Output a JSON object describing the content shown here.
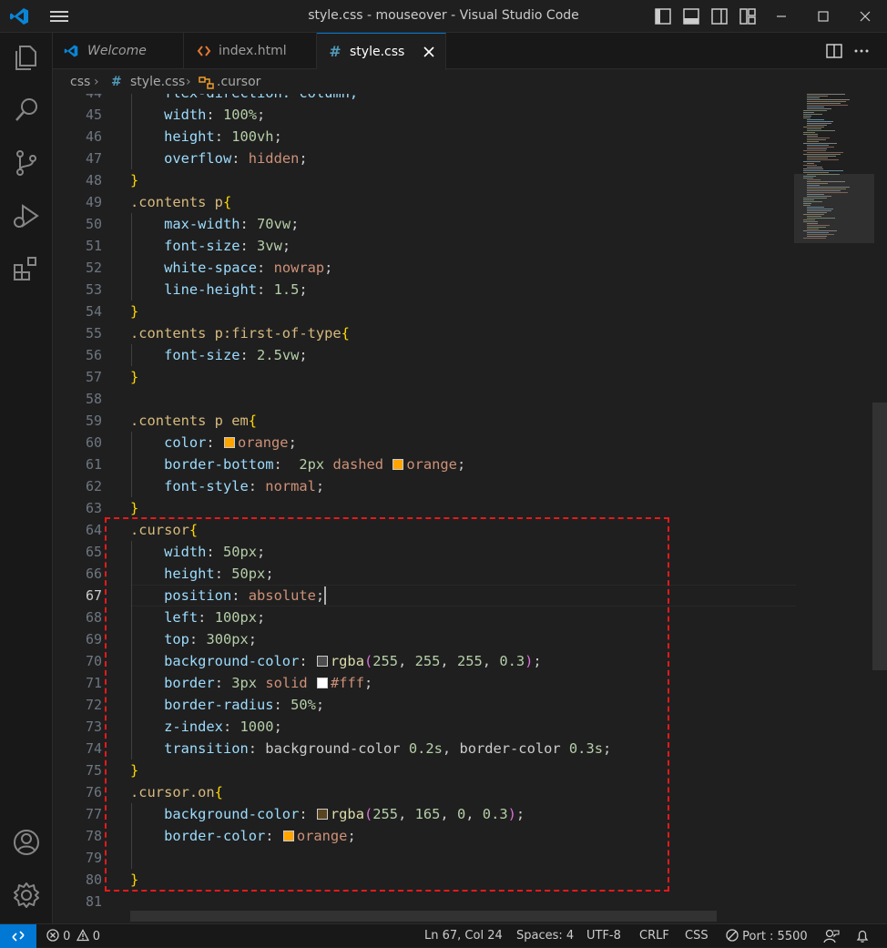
{
  "window": {
    "title": "style.css - mouseover - Visual Studio Code"
  },
  "titlebar": {
    "icons": [
      "vscode-logo-icon",
      "menu-icon",
      "toggle-primary-sidebar-icon",
      "toggle-panel-icon",
      "toggle-secondary-sidebar-icon",
      "customize-layout-icon",
      "minimize-icon",
      "maximize-icon",
      "close-icon"
    ]
  },
  "activity_bar": {
    "items": [
      "explorer-icon",
      "search-icon",
      "source-control-icon",
      "run-debug-icon",
      "extensions-icon",
      "account-icon",
      "manage-gear-icon"
    ]
  },
  "tabs": [
    {
      "label": "Welcome",
      "icon": "vscode-logo-icon",
      "active": false
    },
    {
      "label": "index.html",
      "icon": "html-icon",
      "active": false
    },
    {
      "label": "style.css",
      "icon": "css-hash-icon",
      "active": true
    }
  ],
  "breadcrumb": {
    "folder": "css",
    "file": "style.css",
    "symbol": ".cursor"
  },
  "editor": {
    "first_partial_line_number": "44",
    "first_partial_line_text": "    flex-direction: column;",
    "current_line": "67",
    "lines": [
      {
        "n": "45",
        "tokens": [
          [
            "ind",
            "    "
          ],
          [
            "prop",
            "width"
          ],
          [
            "p",
            ": "
          ],
          [
            "num",
            "100%"
          ],
          [
            "p",
            ";"
          ]
        ]
      },
      {
        "n": "46",
        "tokens": [
          [
            "ind",
            "    "
          ],
          [
            "prop",
            "height"
          ],
          [
            "p",
            ": "
          ],
          [
            "num",
            "100vh"
          ],
          [
            "p",
            ";"
          ]
        ]
      },
      {
        "n": "47",
        "tokens": [
          [
            "ind",
            "    "
          ],
          [
            "prop",
            "overflow"
          ],
          [
            "p",
            ": "
          ],
          [
            "val",
            "hidden"
          ],
          [
            "p",
            ";"
          ]
        ]
      },
      {
        "n": "48",
        "tokens": [
          [
            "br",
            "}"
          ]
        ]
      },
      {
        "n": "49",
        "tokens": [
          [
            "sel",
            ".contents p"
          ],
          [
            "br",
            "{"
          ]
        ]
      },
      {
        "n": "50",
        "tokens": [
          [
            "ind",
            "    "
          ],
          [
            "prop",
            "max-width"
          ],
          [
            "p",
            ": "
          ],
          [
            "num",
            "70vw"
          ],
          [
            "p",
            ";"
          ]
        ]
      },
      {
        "n": "51",
        "tokens": [
          [
            "ind",
            "    "
          ],
          [
            "prop",
            "font-size"
          ],
          [
            "p",
            ": "
          ],
          [
            "num",
            "3vw"
          ],
          [
            "p",
            ";"
          ]
        ]
      },
      {
        "n": "52",
        "tokens": [
          [
            "ind",
            "    "
          ],
          [
            "prop",
            "white-space"
          ],
          [
            "p",
            ": "
          ],
          [
            "val",
            "nowrap"
          ],
          [
            "p",
            ";"
          ]
        ]
      },
      {
        "n": "53",
        "tokens": [
          [
            "ind",
            "    "
          ],
          [
            "prop",
            "line-height"
          ],
          [
            "p",
            ": "
          ],
          [
            "num",
            "1.5"
          ],
          [
            "p",
            ";"
          ]
        ]
      },
      {
        "n": "54",
        "tokens": [
          [
            "br",
            "}"
          ]
        ]
      },
      {
        "n": "55",
        "tokens": [
          [
            "sel",
            ".contents p:first-of-type"
          ],
          [
            "br",
            "{"
          ]
        ]
      },
      {
        "n": "56",
        "tokens": [
          [
            "ind",
            "    "
          ],
          [
            "prop",
            "font-size"
          ],
          [
            "p",
            ": "
          ],
          [
            "num",
            "2.5vw"
          ],
          [
            "p",
            ";"
          ]
        ]
      },
      {
        "n": "57",
        "tokens": [
          [
            "br",
            "}"
          ]
        ]
      },
      {
        "n": "58",
        "tokens": []
      },
      {
        "n": "59",
        "tokens": [
          [
            "sel",
            ".contents p em"
          ],
          [
            "br",
            "{"
          ]
        ]
      },
      {
        "n": "60",
        "tokens": [
          [
            "ind",
            "    "
          ],
          [
            "prop",
            "color"
          ],
          [
            "p",
            ": "
          ],
          [
            "sw",
            "#ffa500"
          ],
          [
            "val",
            "orange"
          ],
          [
            "p",
            ";"
          ]
        ]
      },
      {
        "n": "61",
        "tokens": [
          [
            "ind",
            "    "
          ],
          [
            "prop",
            "border-bottom"
          ],
          [
            "p",
            ":  "
          ],
          [
            "num",
            "2px"
          ],
          [
            "p",
            " "
          ],
          [
            "val",
            "dashed"
          ],
          [
            "p",
            " "
          ],
          [
            "sw",
            "#ffa500"
          ],
          [
            "val",
            "orange"
          ],
          [
            "p",
            ";"
          ]
        ]
      },
      {
        "n": "62",
        "tokens": [
          [
            "ind",
            "    "
          ],
          [
            "prop",
            "font-style"
          ],
          [
            "p",
            ": "
          ],
          [
            "val",
            "normal"
          ],
          [
            "p",
            ";"
          ]
        ]
      },
      {
        "n": "63",
        "tokens": [
          [
            "br",
            "}"
          ]
        ]
      },
      {
        "n": "64",
        "tokens": [
          [
            "sel",
            ".cursor"
          ],
          [
            "br",
            "{"
          ]
        ]
      },
      {
        "n": "65",
        "tokens": [
          [
            "ind",
            "    "
          ],
          [
            "prop",
            "width"
          ],
          [
            "p",
            ": "
          ],
          [
            "num",
            "50px"
          ],
          [
            "p",
            ";"
          ]
        ]
      },
      {
        "n": "66",
        "tokens": [
          [
            "ind",
            "    "
          ],
          [
            "prop",
            "height"
          ],
          [
            "p",
            ": "
          ],
          [
            "num",
            "50px"
          ],
          [
            "p",
            ";"
          ]
        ]
      },
      {
        "n": "67",
        "tokens": [
          [
            "ind",
            "    "
          ],
          [
            "prop",
            "position"
          ],
          [
            "p",
            ": "
          ],
          [
            "val",
            "absolute"
          ],
          [
            "p",
            ";"
          ]
        ]
      },
      {
        "n": "68",
        "tokens": [
          [
            "ind",
            "    "
          ],
          [
            "prop",
            "left"
          ],
          [
            "p",
            ": "
          ],
          [
            "num",
            "100px"
          ],
          [
            "p",
            ";"
          ]
        ]
      },
      {
        "n": "69",
        "tokens": [
          [
            "ind",
            "    "
          ],
          [
            "prop",
            "top"
          ],
          [
            "p",
            ": "
          ],
          [
            "num",
            "300px"
          ],
          [
            "p",
            ";"
          ]
        ]
      },
      {
        "n": "70",
        "tokens": [
          [
            "ind",
            "    "
          ],
          [
            "prop",
            "background-color"
          ],
          [
            "p",
            ": "
          ],
          [
            "sw",
            "#4d4d4d"
          ],
          [
            "fn",
            "rgba"
          ],
          [
            "pn",
            "("
          ],
          [
            "num",
            "255"
          ],
          [
            "p",
            ", "
          ],
          [
            "num",
            "255"
          ],
          [
            "p",
            ", "
          ],
          [
            "num",
            "255"
          ],
          [
            "p",
            ", "
          ],
          [
            "num",
            "0.3"
          ],
          [
            "pn",
            ")"
          ],
          [
            "p",
            ";"
          ]
        ]
      },
      {
        "n": "71",
        "tokens": [
          [
            "ind",
            "    "
          ],
          [
            "prop",
            "border"
          ],
          [
            "p",
            ": "
          ],
          [
            "num",
            "3px"
          ],
          [
            "p",
            " "
          ],
          [
            "val",
            "solid"
          ],
          [
            "p",
            " "
          ],
          [
            "sw",
            "#ffffff"
          ],
          [
            "val",
            "#fff"
          ],
          [
            "p",
            ";"
          ]
        ]
      },
      {
        "n": "72",
        "tokens": [
          [
            "ind",
            "    "
          ],
          [
            "prop",
            "border-radius"
          ],
          [
            "p",
            ": "
          ],
          [
            "num",
            "50%"
          ],
          [
            "p",
            ";"
          ]
        ]
      },
      {
        "n": "73",
        "tokens": [
          [
            "ind",
            "    "
          ],
          [
            "prop",
            "z-index"
          ],
          [
            "p",
            ": "
          ],
          [
            "num",
            "1000"
          ],
          [
            "p",
            ";"
          ]
        ]
      },
      {
        "n": "74",
        "tokens": [
          [
            "ind",
            "    "
          ],
          [
            "prop",
            "transition"
          ],
          [
            "p",
            ": "
          ],
          [
            "p",
            "background-color "
          ],
          [
            "num",
            "0.2s"
          ],
          [
            "p",
            ", border-color "
          ],
          [
            "num",
            "0.3s"
          ],
          [
            "p",
            ";"
          ]
        ]
      },
      {
        "n": "75",
        "tokens": [
          [
            "br",
            "}"
          ]
        ]
      },
      {
        "n": "76",
        "tokens": [
          [
            "sel",
            ".cursor.on"
          ],
          [
            "br",
            "{"
          ]
        ]
      },
      {
        "n": "77",
        "tokens": [
          [
            "ind",
            "    "
          ],
          [
            "prop",
            "background-color"
          ],
          [
            "p",
            ": "
          ],
          [
            "sw",
            "#5a4420"
          ],
          [
            "fn",
            "rgba"
          ],
          [
            "pn",
            "("
          ],
          [
            "num",
            "255"
          ],
          [
            "p",
            ", "
          ],
          [
            "num",
            "165"
          ],
          [
            "p",
            ", "
          ],
          [
            "num",
            "0"
          ],
          [
            "p",
            ", "
          ],
          [
            "num",
            "0.3"
          ],
          [
            "pn",
            ")"
          ],
          [
            "p",
            ";"
          ]
        ]
      },
      {
        "n": "78",
        "tokens": [
          [
            "ind",
            "    "
          ],
          [
            "prop",
            "border-color"
          ],
          [
            "p",
            ": "
          ],
          [
            "sw",
            "#ffa500"
          ],
          [
            "val",
            "orange"
          ],
          [
            "p",
            ";"
          ]
        ]
      },
      {
        "n": "79",
        "tokens": []
      },
      {
        "n": "80",
        "tokens": [
          [
            "br",
            "}"
          ]
        ]
      },
      {
        "n": "81",
        "tokens": []
      }
    ]
  },
  "colors": {
    "accent": "#0078d4",
    "highlight_box": "#e8191b",
    "swatch_orange": "#ffa500"
  },
  "statusbar": {
    "errors": "0",
    "warnings": "0",
    "position": "Ln 67, Col 24",
    "indent": "Spaces: 4",
    "encoding": "UTF-8",
    "eol": "CRLF",
    "language": "CSS",
    "port": "Port : 5500"
  }
}
